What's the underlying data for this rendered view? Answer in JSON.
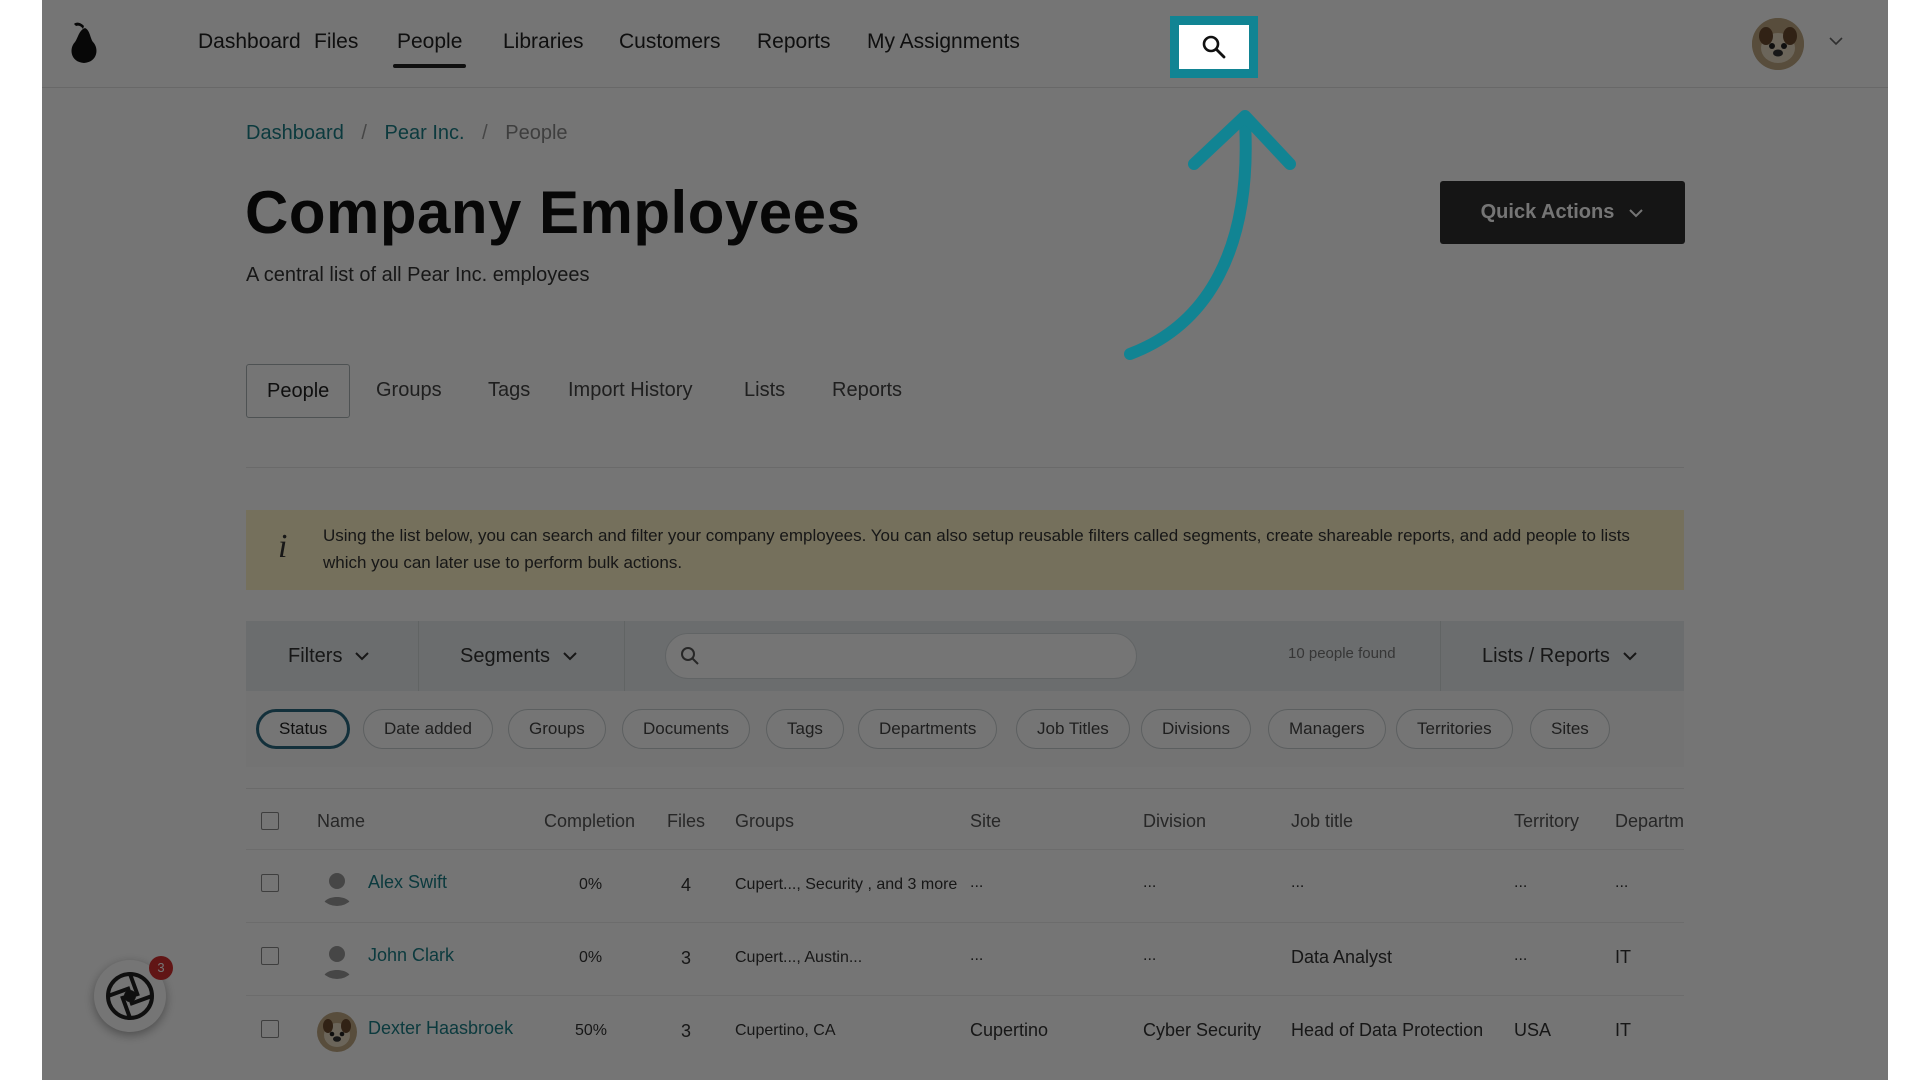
{
  "nav": {
    "items": [
      "Dashboard",
      "Files",
      "People",
      "Libraries",
      "Customers",
      "Reports",
      "My Assignments"
    ],
    "active": "People"
  },
  "breadcrumb": {
    "items": [
      "Dashboard",
      "Pear Inc.",
      "People"
    ],
    "separator": "/"
  },
  "page": {
    "title": "Company Employees",
    "subtitle": "A central list of all Pear Inc. employees",
    "quick_actions_label": "Quick Actions"
  },
  "tabs": [
    "People",
    "Groups",
    "Tags",
    "Import History",
    "Lists",
    "Reports"
  ],
  "info": {
    "text": "Using the list below, you can search and filter your company employees. You can also setup reusable filters called segments, create shareable reports, and add people to lists which you can later use to perform bulk actions."
  },
  "toolbar": {
    "filters_label": "Filters",
    "segments_label": "Segments",
    "search_placeholder": "",
    "found_text": "10 people found",
    "lists_reports_label": "Lists / Reports"
  },
  "chips": [
    "Status",
    "Date added",
    "Groups",
    "Documents",
    "Tags",
    "Departments",
    "Job Titles",
    "Divisions",
    "Managers",
    "Territories",
    "Sites"
  ],
  "table": {
    "columns": [
      "Name",
      "Completion",
      "Files",
      "Groups",
      "Site",
      "Division",
      "Job title",
      "Territory",
      "Departm"
    ],
    "rows": [
      {
        "name": "Alex Swift",
        "completion": "0%",
        "files": "4",
        "groups": "Cupert..., Security , and 3 more",
        "site": "...",
        "division": "...",
        "job_title": "...",
        "territory": "...",
        "department": "..."
      },
      {
        "name": "John Clark",
        "completion": "0%",
        "files": "3",
        "groups": "Cupert..., Austin...",
        "site": "...",
        "division": "...",
        "job_title": "Data Analyst",
        "territory": "...",
        "department": "IT"
      },
      {
        "name": "Dexter Haasbroek",
        "completion": "50%",
        "files": "3",
        "groups": "Cupertino, CA",
        "site": "Cupertino",
        "division": "Cyber Security",
        "job_title": "Head of Data Protection",
        "territory": "USA",
        "department": "IT"
      }
    ]
  },
  "widget": {
    "badge_count": "3"
  },
  "colors": {
    "accent": "#118493",
    "link": "#1b7f87",
    "overlay": "rgba(0,0,0,0.54)",
    "info_bg": "#fff4c8"
  }
}
